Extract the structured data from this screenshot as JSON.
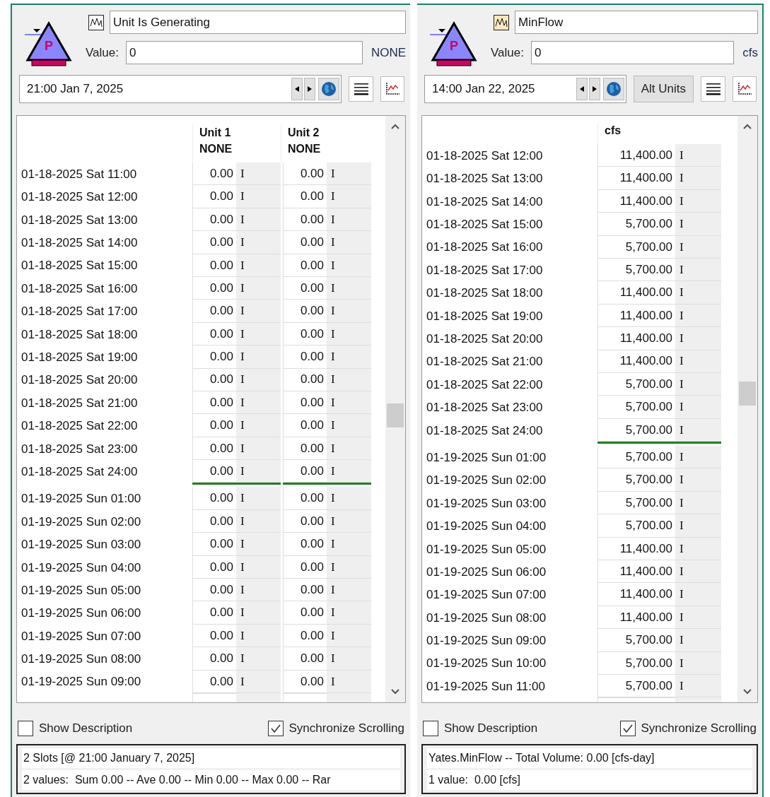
{
  "panels": [
    {
      "icon_letter": "P",
      "title": "Unit Is Generating",
      "value_label": "Value:",
      "value": "0",
      "value_unit": "NONE",
      "date": "21:00 Jan 7, 2025",
      "columns": [
        {
          "name": "Unit 1",
          "unit": "NONE"
        },
        {
          "name": "Unit 2",
          "unit": "NONE"
        }
      ],
      "rows": [
        {
          "date": "01-18-2025 Sat 11:00",
          "cells": [
            {
              "value": "0.00",
              "flag": "I"
            },
            {
              "value": "0.00",
              "flag": "I"
            }
          ],
          "day_end": false
        },
        {
          "date": "01-18-2025 Sat 12:00",
          "cells": [
            {
              "value": "0.00",
              "flag": "I"
            },
            {
              "value": "0.00",
              "flag": "I"
            }
          ],
          "day_end": false
        },
        {
          "date": "01-18-2025 Sat 13:00",
          "cells": [
            {
              "value": "0.00",
              "flag": "I"
            },
            {
              "value": "0.00",
              "flag": "I"
            }
          ],
          "day_end": false
        },
        {
          "date": "01-18-2025 Sat 14:00",
          "cells": [
            {
              "value": "0.00",
              "flag": "I"
            },
            {
              "value": "0.00",
              "flag": "I"
            }
          ],
          "day_end": false
        },
        {
          "date": "01-18-2025 Sat 15:00",
          "cells": [
            {
              "value": "0.00",
              "flag": "I"
            },
            {
              "value": "0.00",
              "flag": "I"
            }
          ],
          "day_end": false
        },
        {
          "date": "01-18-2025 Sat 16:00",
          "cells": [
            {
              "value": "0.00",
              "flag": "I"
            },
            {
              "value": "0.00",
              "flag": "I"
            }
          ],
          "day_end": false
        },
        {
          "date": "01-18-2025 Sat 17:00",
          "cells": [
            {
              "value": "0.00",
              "flag": "I"
            },
            {
              "value": "0.00",
              "flag": "I"
            }
          ],
          "day_end": false
        },
        {
          "date": "01-18-2025 Sat 18:00",
          "cells": [
            {
              "value": "0.00",
              "flag": "I"
            },
            {
              "value": "0.00",
              "flag": "I"
            }
          ],
          "day_end": false
        },
        {
          "date": "01-18-2025 Sat 19:00",
          "cells": [
            {
              "value": "0.00",
              "flag": "I"
            },
            {
              "value": "0.00",
              "flag": "I"
            }
          ],
          "day_end": false
        },
        {
          "date": "01-18-2025 Sat 20:00",
          "cells": [
            {
              "value": "0.00",
              "flag": "I"
            },
            {
              "value": "0.00",
              "flag": "I"
            }
          ],
          "day_end": false
        },
        {
          "date": "01-18-2025 Sat 21:00",
          "cells": [
            {
              "value": "0.00",
              "flag": "I"
            },
            {
              "value": "0.00",
              "flag": "I"
            }
          ],
          "day_end": false
        },
        {
          "date": "01-18-2025 Sat 22:00",
          "cells": [
            {
              "value": "0.00",
              "flag": "I"
            },
            {
              "value": "0.00",
              "flag": "I"
            }
          ],
          "day_end": false
        },
        {
          "date": "01-18-2025 Sat 23:00",
          "cells": [
            {
              "value": "0.00",
              "flag": "I"
            },
            {
              "value": "0.00",
              "flag": "I"
            }
          ],
          "day_end": false
        },
        {
          "date": "01-18-2025 Sat 24:00",
          "cells": [
            {
              "value": "0.00",
              "flag": "I"
            },
            {
              "value": "0.00",
              "flag": "I"
            }
          ],
          "day_end": true
        },
        {
          "date": "01-19-2025 Sun 01:00",
          "cells": [
            {
              "value": "0.00",
              "flag": "I"
            },
            {
              "value": "0.00",
              "flag": "I"
            }
          ],
          "day_end": false
        },
        {
          "date": "01-19-2025 Sun 02:00",
          "cells": [
            {
              "value": "0.00",
              "flag": "I"
            },
            {
              "value": "0.00",
              "flag": "I"
            }
          ],
          "day_end": false
        },
        {
          "date": "01-19-2025 Sun 03:00",
          "cells": [
            {
              "value": "0.00",
              "flag": "I"
            },
            {
              "value": "0.00",
              "flag": "I"
            }
          ],
          "day_end": false
        },
        {
          "date": "01-19-2025 Sun 04:00",
          "cells": [
            {
              "value": "0.00",
              "flag": "I"
            },
            {
              "value": "0.00",
              "flag": "I"
            }
          ],
          "day_end": false
        },
        {
          "date": "01-19-2025 Sun 05:00",
          "cells": [
            {
              "value": "0.00",
              "flag": "I"
            },
            {
              "value": "0.00",
              "flag": "I"
            }
          ],
          "day_end": false
        },
        {
          "date": "01-19-2025 Sun 06:00",
          "cells": [
            {
              "value": "0.00",
              "flag": "I"
            },
            {
              "value": "0.00",
              "flag": "I"
            }
          ],
          "day_end": false
        },
        {
          "date": "01-19-2025 Sun 07:00",
          "cells": [
            {
              "value": "0.00",
              "flag": "I"
            },
            {
              "value": "0.00",
              "flag": "I"
            }
          ],
          "day_end": false
        },
        {
          "date": "01-19-2025 Sun 08:00",
          "cells": [
            {
              "value": "0.00",
              "flag": "I"
            },
            {
              "value": "0.00",
              "flag": "I"
            }
          ],
          "day_end": false
        },
        {
          "date": "01-19-2025 Sun 09:00",
          "cells": [
            {
              "value": "0.00",
              "flag": "I"
            },
            {
              "value": "0.00",
              "flag": "I"
            }
          ],
          "day_end": false
        }
      ],
      "show_description": {
        "label": "Show Description",
        "checked": false
      },
      "synchronize_scrolling": {
        "label": "Synchronize Scrolling",
        "checked": true
      },
      "status_lines": [
        "2 Slots [@ 21:00 January 7, 2025]",
        "2 values:  Sum 0.00 -- Ave 0.00 -- Min 0.00 -- Max 0.00 -- Rar"
      ]
    },
    {
      "icon_letter": "P",
      "title": "MinFlow",
      "value_label": "Value:",
      "value": "0",
      "value_unit": "cfs",
      "date": "14:00 Jan 22, 2025",
      "alt_units_button": "Alt Units",
      "columns": [
        {
          "unit": "cfs"
        }
      ],
      "rows": [
        {
          "date": "01-18-2025 Sat 12:00",
          "cells": [
            {
              "value": "11,400.00",
              "flag": "I"
            }
          ],
          "day_end": false
        },
        {
          "date": "01-18-2025 Sat 13:00",
          "cells": [
            {
              "value": "11,400.00",
              "flag": "I"
            }
          ],
          "day_end": false
        },
        {
          "date": "01-18-2025 Sat 14:00",
          "cells": [
            {
              "value": "11,400.00",
              "flag": "I"
            }
          ],
          "day_end": false
        },
        {
          "date": "01-18-2025 Sat 15:00",
          "cells": [
            {
              "value": "5,700.00",
              "flag": "I"
            }
          ],
          "day_end": false
        },
        {
          "date": "01-18-2025 Sat 16:00",
          "cells": [
            {
              "value": "5,700.00",
              "flag": "I"
            }
          ],
          "day_end": false
        },
        {
          "date": "01-18-2025 Sat 17:00",
          "cells": [
            {
              "value": "5,700.00",
              "flag": "I"
            }
          ],
          "day_end": false
        },
        {
          "date": "01-18-2025 Sat 18:00",
          "cells": [
            {
              "value": "11,400.00",
              "flag": "I"
            }
          ],
          "day_end": false
        },
        {
          "date": "01-18-2025 Sat 19:00",
          "cells": [
            {
              "value": "11,400.00",
              "flag": "I"
            }
          ],
          "day_end": false
        },
        {
          "date": "01-18-2025 Sat 20:00",
          "cells": [
            {
              "value": "11,400.00",
              "flag": "I"
            }
          ],
          "day_end": false
        },
        {
          "date": "01-18-2025 Sat 21:00",
          "cells": [
            {
              "value": "11,400.00",
              "flag": "I"
            }
          ],
          "day_end": false
        },
        {
          "date": "01-18-2025 Sat 22:00",
          "cells": [
            {
              "value": "5,700.00",
              "flag": "I"
            }
          ],
          "day_end": false
        },
        {
          "date": "01-18-2025 Sat 23:00",
          "cells": [
            {
              "value": "5,700.00",
              "flag": "I"
            }
          ],
          "day_end": false
        },
        {
          "date": "01-18-2025 Sat 24:00",
          "cells": [
            {
              "value": "5,700.00",
              "flag": "I"
            }
          ],
          "day_end": true
        },
        {
          "date": "01-19-2025 Sun 01:00",
          "cells": [
            {
              "value": "5,700.00",
              "flag": "I"
            }
          ],
          "day_end": false
        },
        {
          "date": "01-19-2025 Sun 02:00",
          "cells": [
            {
              "value": "5,700.00",
              "flag": "I"
            }
          ],
          "day_end": false
        },
        {
          "date": "01-19-2025 Sun 03:00",
          "cells": [
            {
              "value": "5,700.00",
              "flag": "I"
            }
          ],
          "day_end": false
        },
        {
          "date": "01-19-2025 Sun 04:00",
          "cells": [
            {
              "value": "5,700.00",
              "flag": "I"
            }
          ],
          "day_end": false
        },
        {
          "date": "01-19-2025 Sun 05:00",
          "cells": [
            {
              "value": "11,400.00",
              "flag": "I"
            }
          ],
          "day_end": false
        },
        {
          "date": "01-19-2025 Sun 06:00",
          "cells": [
            {
              "value": "11,400.00",
              "flag": "I"
            }
          ],
          "day_end": false
        },
        {
          "date": "01-19-2025 Sun 07:00",
          "cells": [
            {
              "value": "11,400.00",
              "flag": "I"
            }
          ],
          "day_end": false
        },
        {
          "date": "01-19-2025 Sun 08:00",
          "cells": [
            {
              "value": "11,400.00",
              "flag": "I"
            }
          ],
          "day_end": false
        },
        {
          "date": "01-19-2025 Sun 09:00",
          "cells": [
            {
              "value": "5,700.00",
              "flag": "I"
            }
          ],
          "day_end": false
        },
        {
          "date": "01-19-2025 Sun 10:00",
          "cells": [
            {
              "value": "5,700.00",
              "flag": "I"
            }
          ],
          "day_end": false
        },
        {
          "date": "01-19-2025 Sun 11:00",
          "cells": [
            {
              "value": "5,700.00",
              "flag": "I"
            }
          ],
          "day_end": false
        }
      ],
      "show_description": {
        "label": "Show Description",
        "checked": false
      },
      "synchronize_scrolling": {
        "label": "Synchronize Scrolling",
        "checked": true
      },
      "status_lines": [
        "Yates.MinFlow -- Total Volume: 0.00 [cfs-day]",
        "1 value:  0.00 [cfs]"
      ]
    }
  ]
}
